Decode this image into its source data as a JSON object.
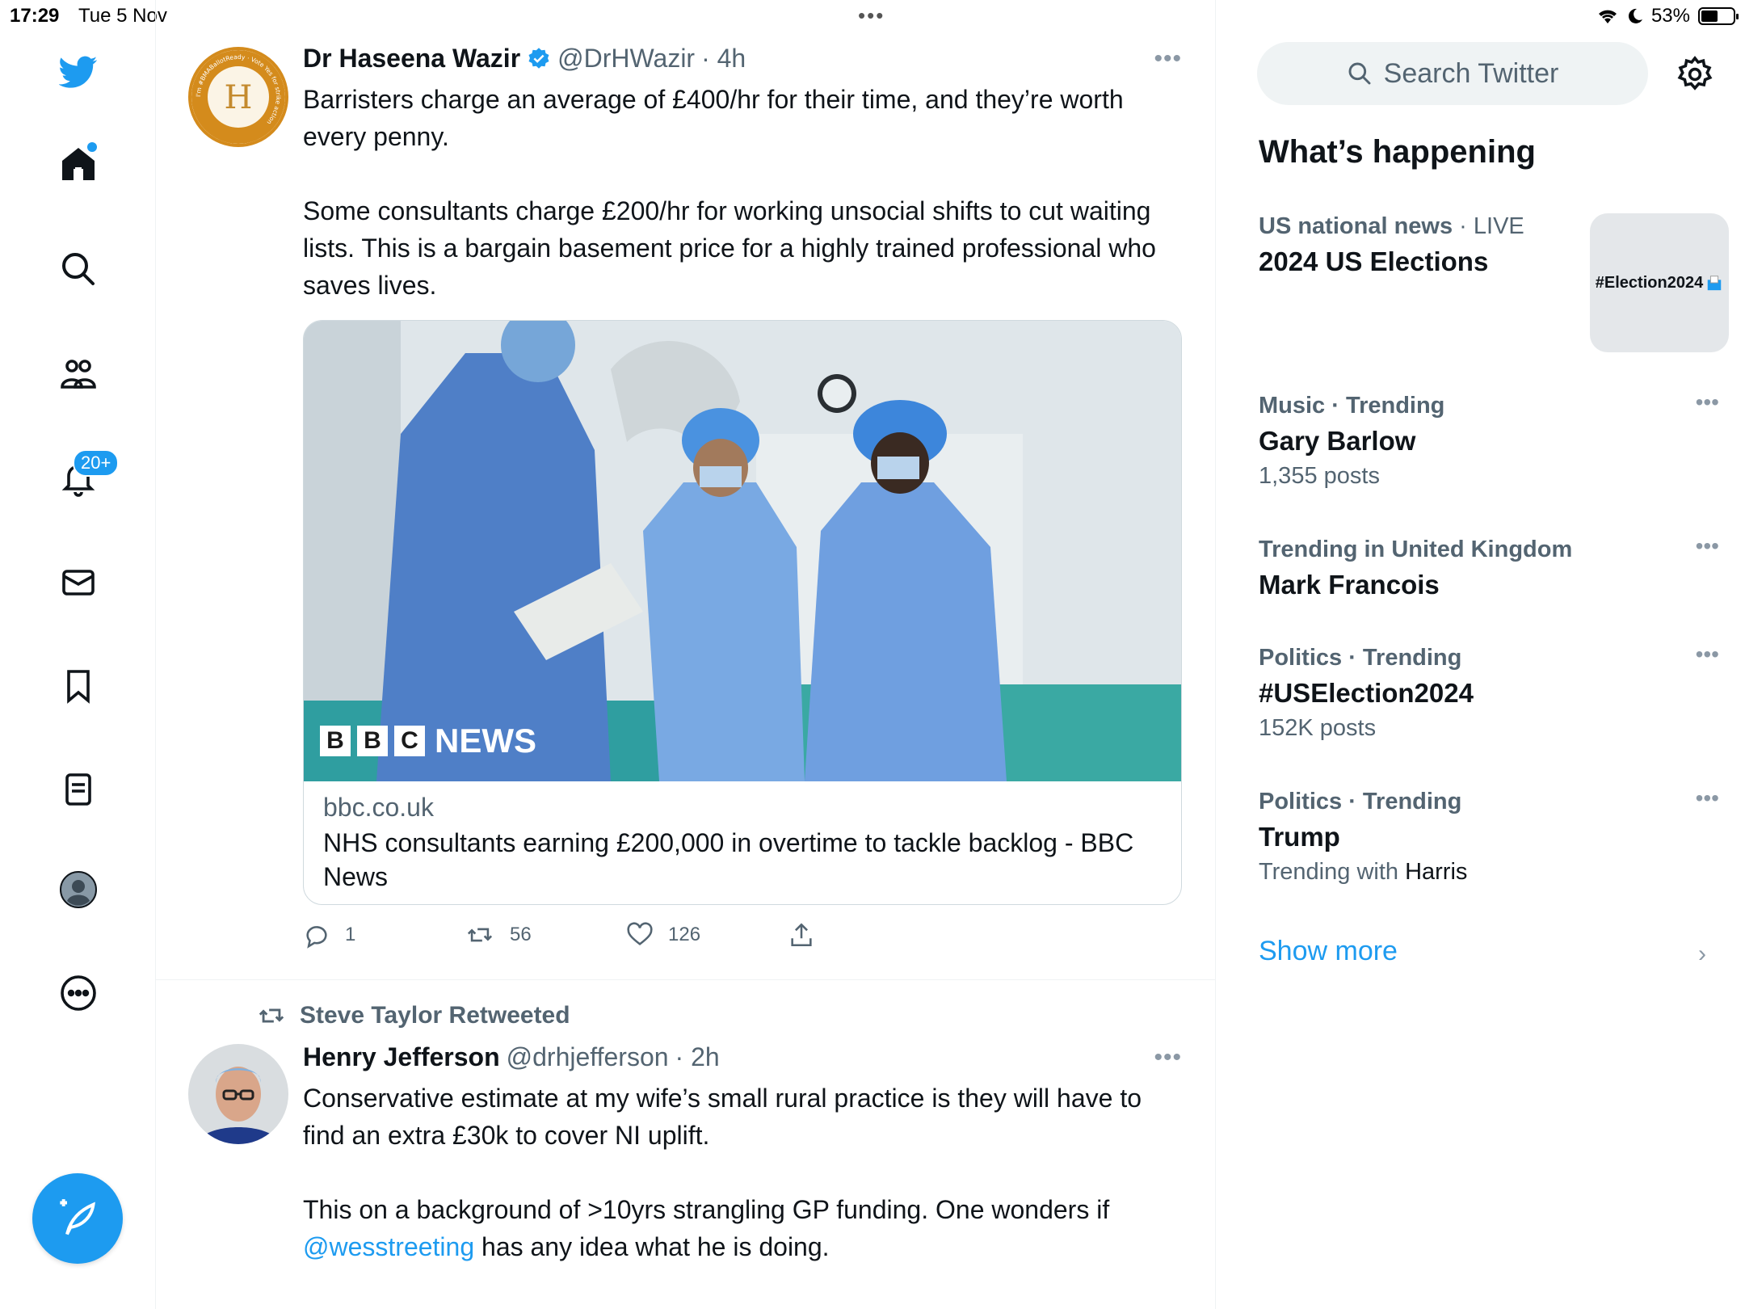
{
  "status_bar": {
    "time": "17:29",
    "date": "Tue 5 Nov",
    "battery": "53%",
    "battery_level": 0.53
  },
  "nav": {
    "notifications_badge": "20+",
    "icons": [
      "twitter-logo-icon",
      "home-icon",
      "search-icon",
      "communities-icon",
      "notifications-icon",
      "messages-icon",
      "bookmarks-icon",
      "lists-icon",
      "profile-icon",
      "more-icon",
      "compose-icon"
    ]
  },
  "tweet1": {
    "name": "Dr Haseena Wazir",
    "handle": "@DrHWazir",
    "time": "· 4h",
    "text": "Barristers charge an average of £400/hr for their time, and they’re worth every penny.\n\nSome consultants charge £200/hr for working unsocial shifts to cut waiting lists. This is a bargain basement price for a highly trained professional who saves lives.",
    "avatar_ring_text": "I'm #BMABallotReady · Vote Yes for strike action",
    "avatar_letter": "H",
    "card": {
      "watermark": "NEWS",
      "domain": "bbc.co.uk",
      "title": "NHS consultants earning £200,000 in overtime to tackle backlog - BBC News"
    },
    "actions": {
      "replies": "1",
      "retweets": "56",
      "likes": "126"
    }
  },
  "tweet2": {
    "retweeted_by": "Steve Taylor Retweeted",
    "name": "Henry Jefferson",
    "handle": "@drhjefferson",
    "time": "· 2h",
    "text_part1": "Conservative estimate at my wife’s small rural practice is they will have to find an extra £30k to cover NI uplift.\n\nThis on a background of >10yrs strangling GP funding. One wonders if ",
    "mention": "@wesstreeting",
    "text_part2": " has any idea what he is doing."
  },
  "sidebar": {
    "search_placeholder": "Search Twitter",
    "heading": "What’s happening",
    "trends": [
      {
        "context": "US national news",
        "live": "· LIVE",
        "title": "2024 US Elections",
        "thumb": "#Election2024"
      },
      {
        "context": "Music · Trending",
        "title": "Gary Barlow",
        "count": "1,355 posts"
      },
      {
        "context": "Trending in United Kingdom",
        "title": "Mark Francois"
      },
      {
        "context": "Politics · Trending",
        "title": "#USElection2024",
        "count": "152K posts"
      },
      {
        "context": "Politics · Trending",
        "title": "Trump",
        "with_prefix": "Trending with",
        "with_name": "Harris"
      }
    ],
    "show_more": "Show more"
  },
  "colors": {
    "accent": "#1d9bf0",
    "text": "#0f1419",
    "muted": "#536471"
  }
}
